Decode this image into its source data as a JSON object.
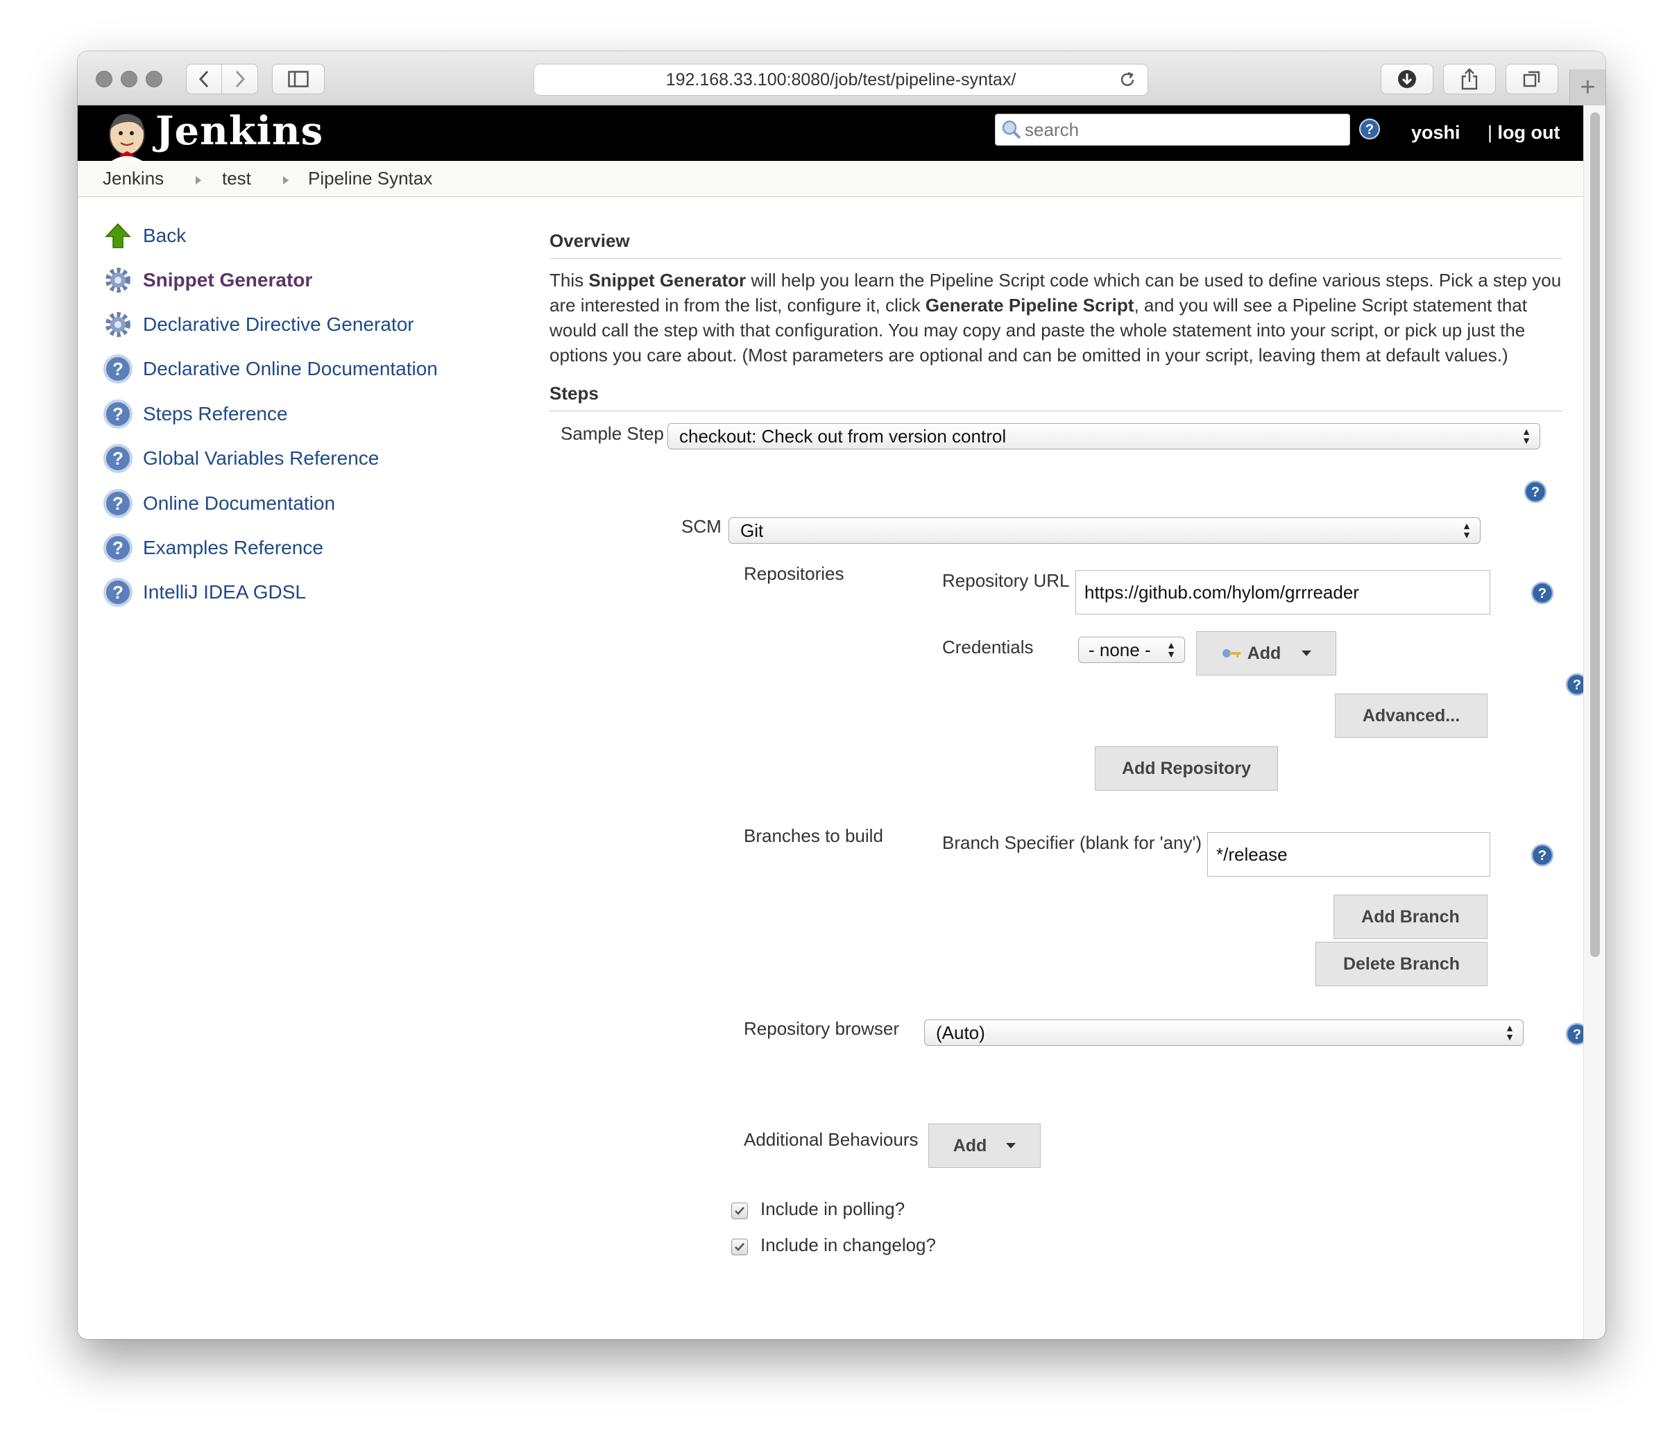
{
  "browser": {
    "address": "192.168.33.100:8080/job/test/pipeline-syntax/"
  },
  "header": {
    "logo_text": "Jenkins",
    "search_placeholder": "search",
    "user": "yoshi",
    "logout": "log out"
  },
  "breadcrumb": [
    "Jenkins",
    "test",
    "Pipeline Syntax"
  ],
  "sidebar": {
    "items": [
      {
        "label": "Back",
        "icon": "up-arrow-icon"
      },
      {
        "label": "Snippet Generator",
        "icon": "gear-icon"
      },
      {
        "label": "Declarative Directive Generator",
        "icon": "gear-icon"
      },
      {
        "label": "Declarative Online Documentation",
        "icon": "help-icon"
      },
      {
        "label": "Steps Reference",
        "icon": "help-icon"
      },
      {
        "label": "Global Variables Reference",
        "icon": "help-icon"
      },
      {
        "label": "Online Documentation",
        "icon": "help-icon"
      },
      {
        "label": "Examples Reference",
        "icon": "help-icon"
      },
      {
        "label": "IntelliJ IDEA GDSL",
        "icon": "help-icon"
      }
    ]
  },
  "overview": {
    "title": "Overview",
    "t1": "This ",
    "b1": "Snippet Generator",
    "t2": " will help you learn the Pipeline Script code which can be used to define various steps. Pick a step you are interested in from the list, configure it, click ",
    "b2": "Generate Pipeline Script",
    "t3": ", and you will see a Pipeline Script statement that would call the step with that configuration. You may copy and paste the whole statement into your script, or pick up just the options you care about. (Most parameters are optional and can be omitted in your script, leaving them at default values.)"
  },
  "steps": {
    "title": "Steps",
    "sample_step_label": "Sample Step",
    "sample_step_value": "checkout: Check out from version control",
    "scm_label": "SCM",
    "scm_value": "Git",
    "repositories_label": "Repositories",
    "repo_url_label": "Repository URL",
    "repo_url_value": "https://github.com/hylom/grrreader",
    "credentials_label": "Credentials",
    "credentials_value": "- none -",
    "add_label": "Add",
    "advanced_label": "Advanced...",
    "add_repository_label": "Add Repository",
    "branches_label": "Branches to build",
    "branch_spec_label": "Branch Specifier (blank for 'any')",
    "branch_spec_value": "*/release",
    "add_branch_label": "Add Branch",
    "delete_branch_label": "Delete Branch",
    "repo_browser_label": "Repository browser",
    "repo_browser_value": "(Auto)",
    "additional_behaviours_label": "Additional Behaviours",
    "additional_add_label": "Add",
    "include_polling_label": "Include in polling?",
    "include_polling_checked": true,
    "include_changelog_label": "Include in changelog?",
    "include_changelog_checked": true
  },
  "colors": {
    "link": "#204a87",
    "link_active": "#5c3566",
    "header_bg": "#000000",
    "button_bg": "#e5e5e5"
  }
}
